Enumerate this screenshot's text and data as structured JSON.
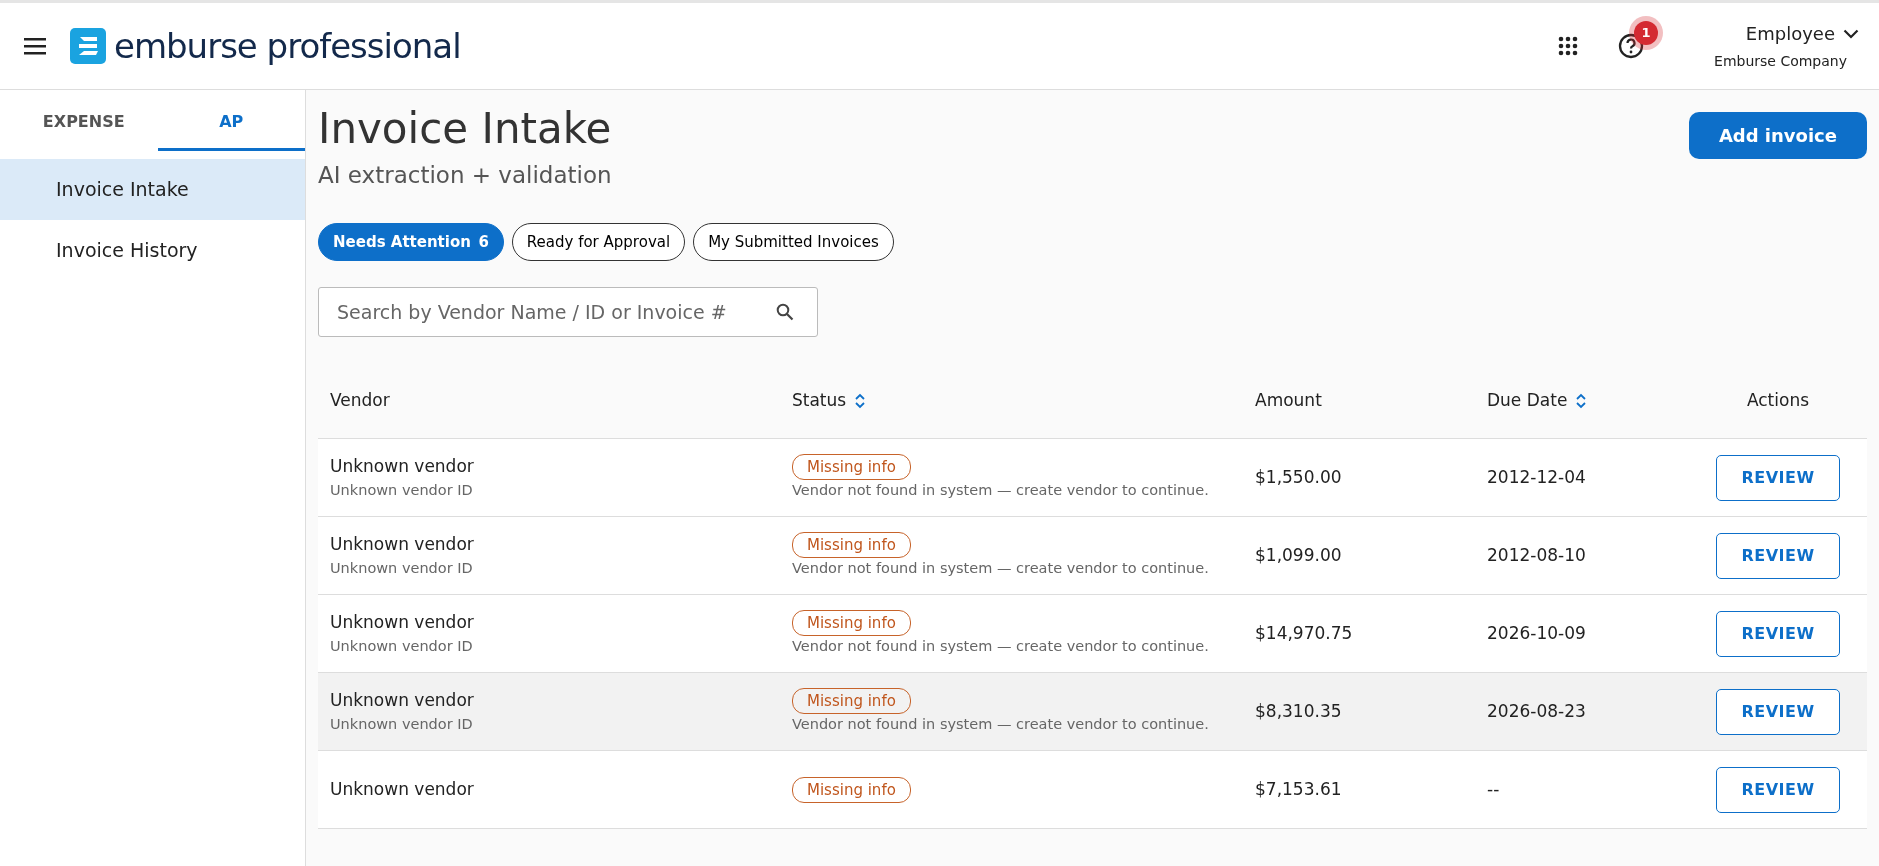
{
  "header": {
    "brand": "emburse professional",
    "help_badge": "1",
    "user": {
      "name": "Employee",
      "company": "Emburse Company"
    }
  },
  "sidebar": {
    "tabs": [
      {
        "label": "EXPENSE",
        "selected": false
      },
      {
        "label": "AP",
        "selected": true
      }
    ],
    "items": [
      {
        "label": "Invoice Intake",
        "selected": true
      },
      {
        "label": "Invoice History",
        "selected": false
      }
    ]
  },
  "page": {
    "title": "Invoice Intake",
    "subtitle": "AI extraction + validation",
    "add_button": "Add invoice"
  },
  "filters": [
    {
      "label": "Needs Attention",
      "count": "6",
      "selected": true
    },
    {
      "label": "Ready for Approval",
      "selected": false
    },
    {
      "label": "My Submitted Invoices",
      "selected": false
    }
  ],
  "search": {
    "placeholder": "Search by Vendor Name / ID or Invoice #"
  },
  "table": {
    "columns": [
      {
        "label": "Vendor",
        "sortable": false
      },
      {
        "label": "Status",
        "sortable": true
      },
      {
        "label": "Amount",
        "sortable": false
      },
      {
        "label": "Due Date",
        "sortable": true
      },
      {
        "label": "Actions",
        "sortable": false
      }
    ],
    "rows": [
      {
        "vendor": "Unknown vendor",
        "vendor_id": "Unknown vendor ID",
        "status": "Missing info",
        "message": "Vendor not found in system — create vendor to continue.",
        "amount": "$1,550.00",
        "due": "2012-12-04",
        "action": "REVIEW",
        "highlighted": false
      },
      {
        "vendor": "Unknown vendor",
        "vendor_id": "Unknown vendor ID",
        "status": "Missing info",
        "message": "Vendor not found in system — create vendor to continue.",
        "amount": "$1,099.00",
        "due": "2012-08-10",
        "action": "REVIEW",
        "highlighted": false
      },
      {
        "vendor": "Unknown vendor",
        "vendor_id": "Unknown vendor ID",
        "status": "Missing info",
        "message": "Vendor not found in system — create vendor to continue.",
        "amount": "$14,970.75",
        "due": "2026-10-09",
        "action": "REVIEW",
        "highlighted": false
      },
      {
        "vendor": "Unknown vendor",
        "vendor_id": "Unknown vendor ID",
        "status": "Missing info",
        "message": "Vendor not found in system — create vendor to continue.",
        "amount": "$8,310.35",
        "due": "2026-08-23",
        "action": "REVIEW",
        "highlighted": true
      },
      {
        "vendor": "Unknown vendor",
        "status": "Missing info",
        "amount": "$7,153.61",
        "due": "--",
        "action": "REVIEW",
        "highlighted": false
      }
    ]
  }
}
